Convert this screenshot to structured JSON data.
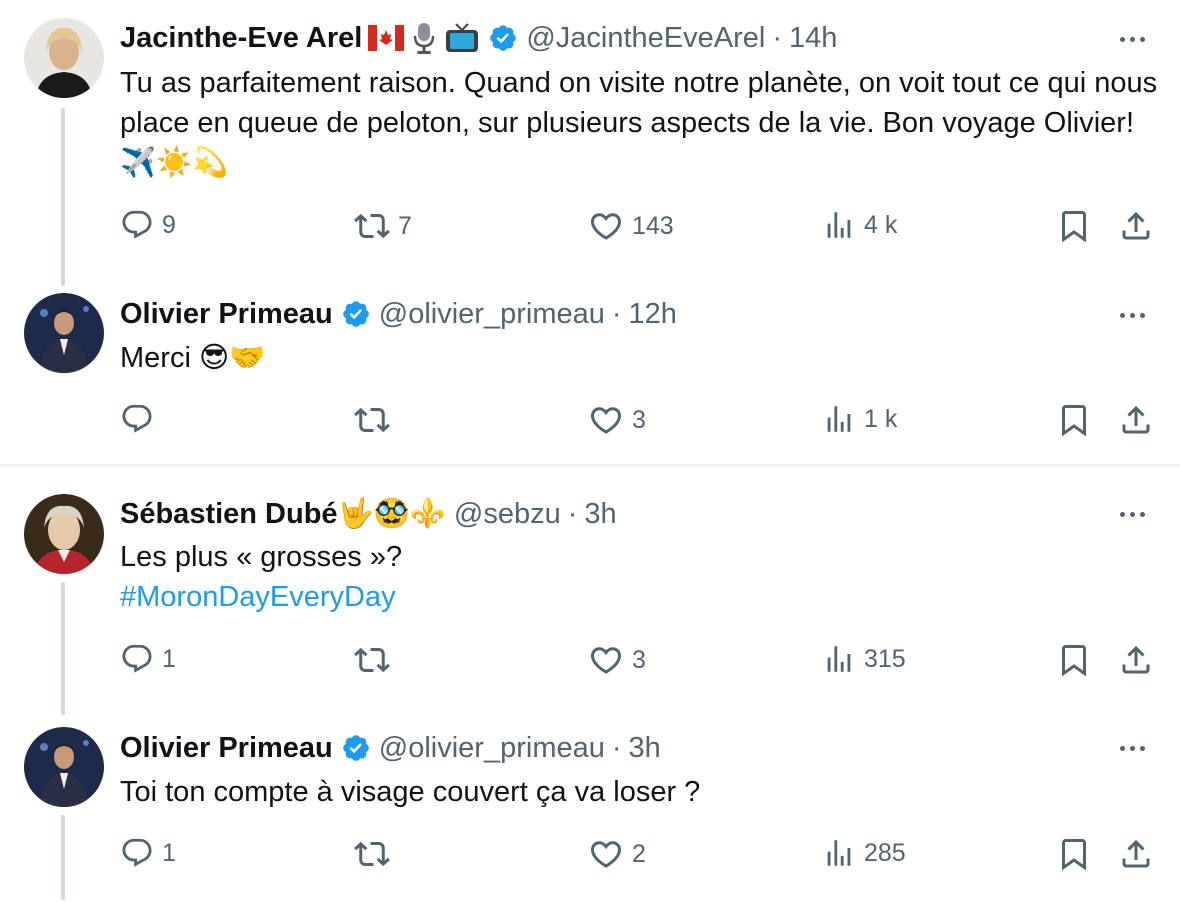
{
  "tweets": [
    {
      "name": "Jacinthe-Eve Arel",
      "handle": "@JacintheEveArel",
      "time": "14h",
      "text": "Tu as parfaitement raison. Quand on visite notre planète, on voit tout ce qui nous place en queue de peloton, sur plusieurs aspects de la vie. Bon voyage Olivier! ✈️☀️💫",
      "replies": "9",
      "retweets": "7",
      "likes": "143",
      "views": "4 k"
    },
    {
      "name": "Olivier Primeau",
      "handle": "@olivier_primeau",
      "time": "12h",
      "text": "Merci 😎🤝",
      "replies": "",
      "retweets": "",
      "likes": "3",
      "views": "1 k"
    },
    {
      "name": "Sébastien Dubé🤟🥸⚜️",
      "handle": "@sebzu",
      "time": "3h",
      "text": "Les plus « grosses »?",
      "hashtag": "#MoronDayEveryDay",
      "replies": "1",
      "retweets": "",
      "likes": "3",
      "views": "315"
    },
    {
      "name": "Olivier Primeau",
      "handle": "@olivier_primeau",
      "time": "3h",
      "text": "Toi ton compte à visage couvert ça va loser ?",
      "replies": "1",
      "retweets": "",
      "likes": "2",
      "views": "285"
    }
  ],
  "colors": {
    "verified": "#1d9bf0",
    "hashtag": "#1d9bf0",
    "muted": "#536471",
    "thread_line": "#cfd9de"
  },
  "icons": [
    "reply-icon",
    "retweet-icon",
    "like-icon",
    "views-icon",
    "bookmark-icon",
    "share-icon",
    "more-icon",
    "verified-badge-icon",
    "canada-flag-icon",
    "microphone-icon",
    "tv-icon"
  ]
}
